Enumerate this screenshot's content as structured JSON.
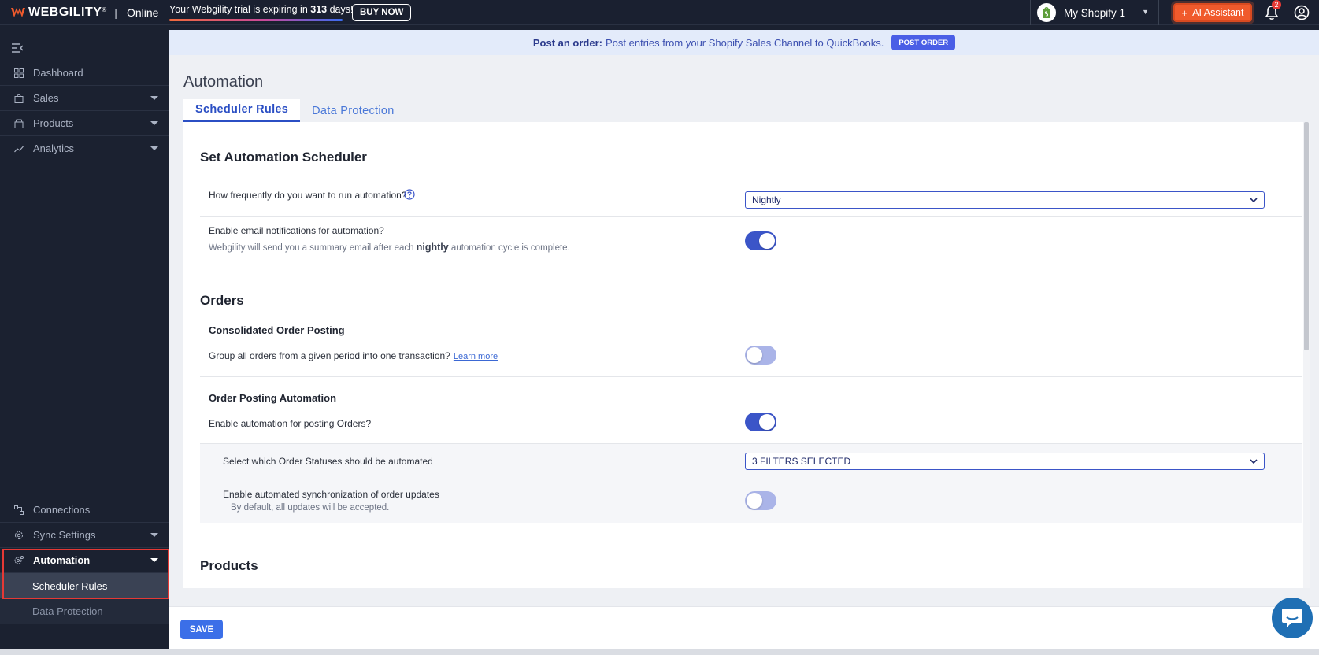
{
  "topbar": {
    "brand": "WEBGILITY",
    "brand_mark": "®",
    "separator": "|",
    "edition": "Online",
    "trial_prefix": "Your Webgility trial is expiring in ",
    "trial_days": "313",
    "trial_suffix": " days!",
    "buy_now": "BUY NOW",
    "store_name": "My Shopify 1",
    "ai_assistant": "AI Assistant",
    "notification_count": "2"
  },
  "sidebar": {
    "items": [
      {
        "label": "Dashboard",
        "icon": "dashboard-icon"
      },
      {
        "label": "Sales",
        "icon": "bag-icon"
      },
      {
        "label": "Products",
        "icon": "box-icon"
      },
      {
        "label": "Analytics",
        "icon": "chart-icon"
      }
    ],
    "bottom_items": [
      {
        "label": "Connections",
        "icon": "connections-icon"
      },
      {
        "label": "Sync Settings",
        "icon": "gear-icon"
      },
      {
        "label": "Automation",
        "icon": "automation-gear-icon"
      }
    ],
    "sub_items": [
      {
        "label": "Scheduler Rules"
      },
      {
        "label": "Data Protection"
      }
    ]
  },
  "banner": {
    "bold": "Post an order:",
    "text": "Post entries from your Shopify Sales Channel to QuickBooks.",
    "button": "POST ORDER"
  },
  "page": {
    "title": "Automation",
    "tabs": [
      {
        "label": "Scheduler Rules"
      },
      {
        "label": "Data Protection"
      }
    ]
  },
  "scheduler": {
    "heading": "Set Automation Scheduler",
    "frequency_label": "How frequently do you want to run automation?",
    "frequency_value": "Nightly",
    "email_label": "Enable email notifications for automation?",
    "email_desc_prefix": "Webgility will send you a summary email after each ",
    "email_desc_bold": "nightly",
    "email_desc_suffix": " automation cycle is complete.",
    "email_enabled": true
  },
  "orders": {
    "heading": "Orders",
    "consolidated_heading": "Consolidated Order Posting",
    "consolidated_label": "Group all orders from a given period into one transaction?",
    "learn_more": "Learn more",
    "consolidated_enabled": false,
    "posting_heading": "Order Posting Automation",
    "posting_label": "Enable automation for posting Orders?",
    "posting_enabled": true,
    "statuses_label": "Select which Order Statuses should be automated",
    "statuses_value": "3 FILTERS SELECTED",
    "sync_label": "Enable automated synchronization of order updates",
    "sync_desc": "By default, all updates will be accepted.",
    "sync_enabled": false
  },
  "products": {
    "heading": "Products"
  },
  "footer": {
    "save": "SAVE"
  },
  "colors": {
    "accent": "#3b55c8",
    "ai_button": "#f05a2c",
    "highlight": "#e53935"
  }
}
